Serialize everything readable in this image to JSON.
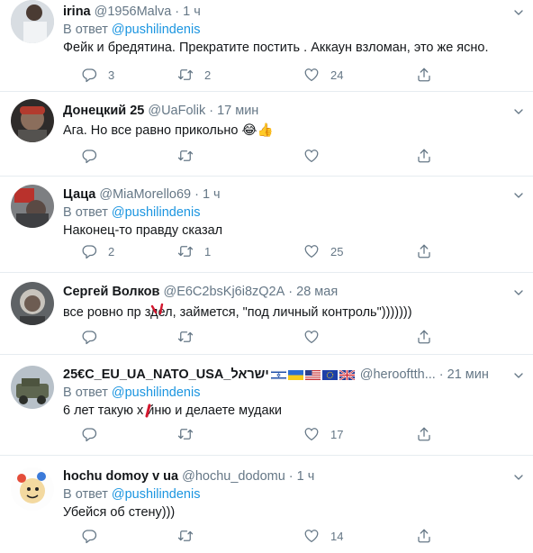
{
  "reply_prefix": "В ответ",
  "tweets": [
    {
      "name": "irina",
      "handle": "@1956Malva",
      "time": "1 ч",
      "reply_to": "@pushilindenis",
      "text": "Фейк и бредятина. Прекратите постить . Аккаун взломан, это же ясно.",
      "replies": "3",
      "retweets": "2",
      "likes": "24"
    },
    {
      "name": "Донецкий 25",
      "handle": "@UaFolik",
      "time": "17 мин",
      "reply_to": "",
      "text": "Ага. Но все равно прикольно 😂👍",
      "replies": "",
      "retweets": "",
      "likes": ""
    },
    {
      "name": "Цаца",
      "handle": "@MiaMorello69",
      "time": "1 ч",
      "reply_to": "@pushilindenis",
      "text": "Наконец-то правду сказал",
      "replies": "2",
      "retweets": "1",
      "likes": "25"
    },
    {
      "name": "Сергей Волков",
      "handle": "@E6C2bsKj6i8zQ2A",
      "time": "28 мая",
      "reply_to": "",
      "text": "все ровно пр  здел, займется, \"под личный контроль\")))))))",
      "replies": "",
      "retweets": "",
      "likes": ""
    },
    {
      "name": "25€C_EU_UA_NATO_USA_ישראל",
      "handle": "@herooftth...",
      "time": "21 мин",
      "reply_to": "@pushilindenis",
      "text": "6 лет такую х  йню и делаете мудаки",
      "replies": "",
      "retweets": "",
      "likes": "17"
    },
    {
      "name": "hochu domoy v ua",
      "handle": "@hochu_dodomu",
      "time": "1 ч",
      "reply_to": "@pushilindenis",
      "text": "Убейся  об  стену)))",
      "replies": "",
      "retweets": "",
      "likes": "14"
    }
  ],
  "colors": {
    "secondary": "#657786",
    "link": "#1b95e0",
    "divider": "#e6ecf0"
  },
  "icons": [
    "reply-icon",
    "retweet-icon",
    "like-icon",
    "share-icon",
    "caret-down-icon"
  ]
}
